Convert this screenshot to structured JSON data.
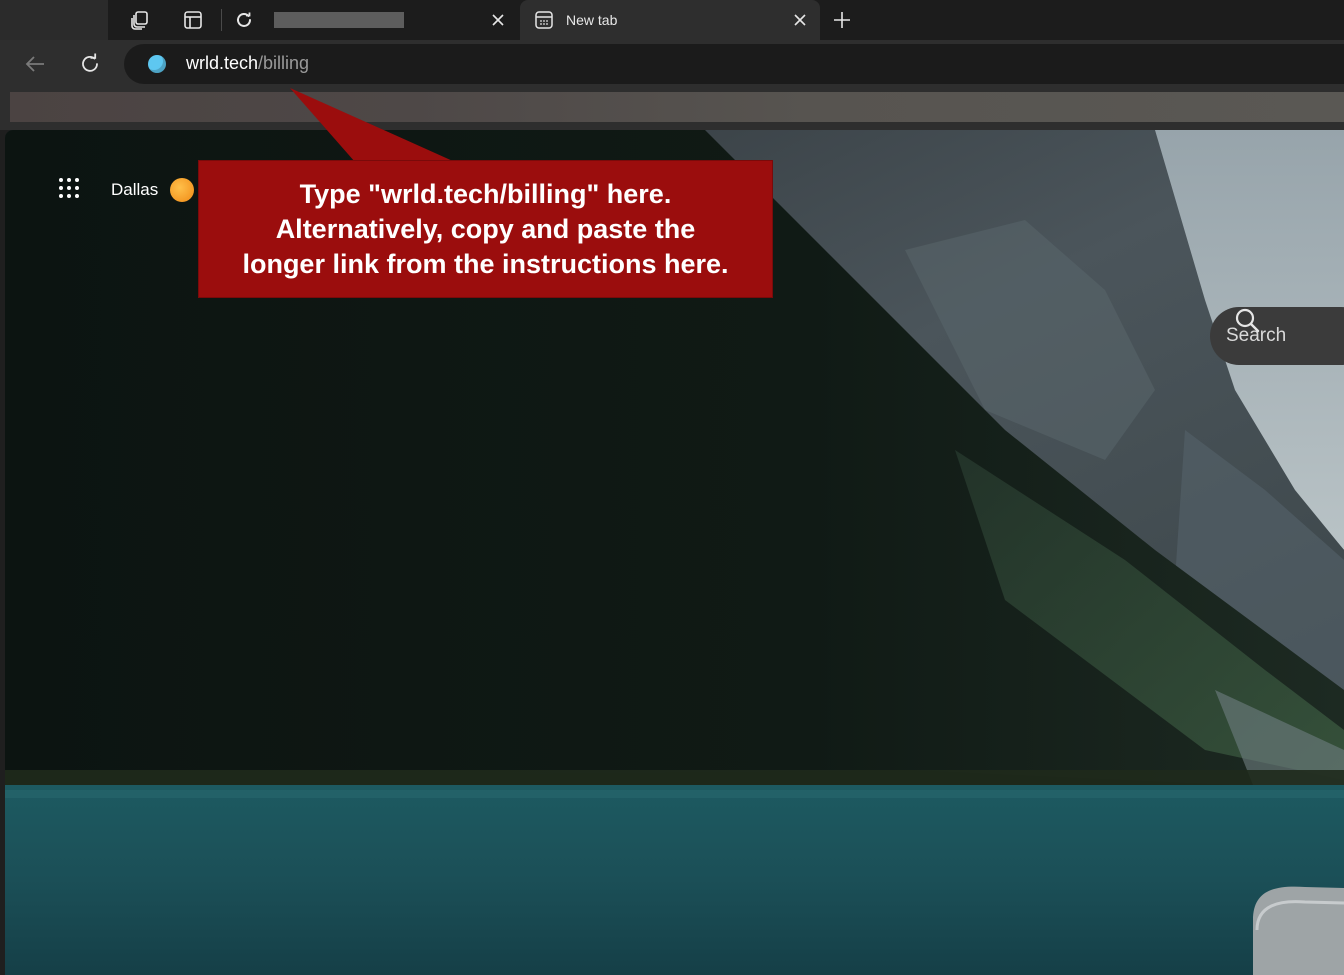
{
  "tabs": {
    "tab1": {
      "title": "",
      "status": "loading"
    },
    "tab2": {
      "title": "New tab"
    }
  },
  "toolbar": {
    "url_host": "wrld.tech",
    "url_path": "/billing"
  },
  "newtab": {
    "weather_city": "Dallas",
    "search_label": "Search"
  },
  "annotation": {
    "line1": "Type \"wrld.tech/billing\" here.",
    "line2": "Alternatively, copy and paste the",
    "line3": "longer link from the instructions here."
  },
  "icons": {
    "workspaces": "workspaces-icon",
    "tab_actions": "tab-actions-icon",
    "loading": "loading-icon",
    "newtab_favicon": "newtab-page-icon",
    "close": "close-icon",
    "add": "plus-icon",
    "back": "back-arrow-icon",
    "refresh": "refresh-icon",
    "apps": "apps-grid-icon",
    "weather": "sun-icon",
    "search": "search-icon"
  },
  "colors": {
    "callout_red": "#9b0d0d",
    "site_dot": "#5ec7f0",
    "sun": "#f5a623"
  }
}
